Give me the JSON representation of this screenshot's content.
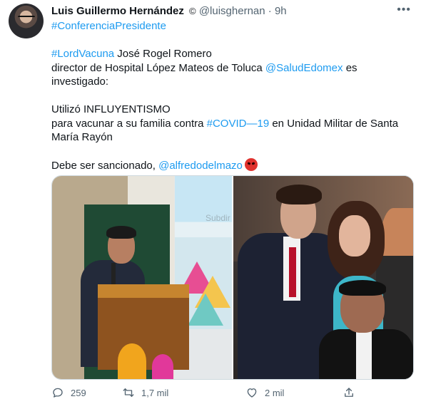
{
  "author": {
    "name": "Luis Guillermo Hernández",
    "verified_symbol": "©",
    "handle": "@luisghernan",
    "time": "· 9h"
  },
  "more_icon": "more-horizontal-icon",
  "hashtag_line": "#ConferenciaPresidente",
  "tweet_body": {
    "hashtag1": "#LordVacuna",
    "line1_rest": " José Rogel Romero",
    "line2_start": "director de Hospital López Mateos de Toluca ",
    "mention1": "@SaludEdomex",
    "line2_end": " es",
    "line3": "investigado:",
    "line4": "Utilizó INFLUYENTISMO",
    "line5_start": "para vacunar a su familia contra ",
    "hashtag2": "#COVID—19",
    "line5_end": " en Unidad Militar de Santa",
    "line6": "María Rayón",
    "line7_start": "Debe ser sancionado, ",
    "mention2": "@alfredodelmazo",
    "emoji_name": "angry-face-emoji"
  },
  "media": {
    "watermark": "Subdir"
  },
  "actions": {
    "reply_count": "259",
    "retweet_count": "1,7 mil",
    "like_count": "2 mil"
  },
  "colors": {
    "link": "#1d9bf0",
    "muted": "#536471",
    "text": "#0f1419"
  }
}
